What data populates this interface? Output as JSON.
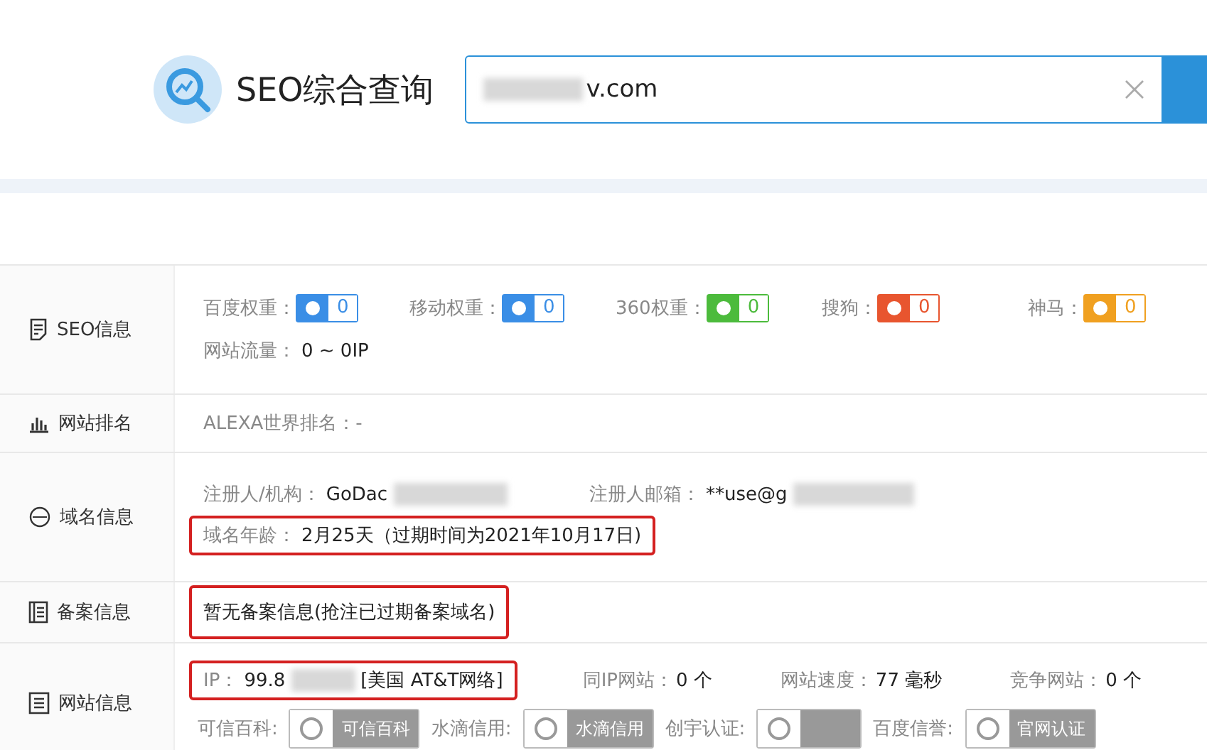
{
  "header": {
    "title": "SEO综合查询",
    "search": {
      "value": "v.com"
    }
  },
  "sections": [
    {
      "kind": "seo",
      "label": "SEO信息",
      "weights": [
        {
          "label": "百度权重：",
          "value": "0",
          "color": "#3a8ee6"
        },
        {
          "label": "移动权重：",
          "value": "0",
          "color": "#3a8ee6"
        },
        {
          "label": "360权重：",
          "value": "0",
          "color": "#4cbb3c"
        },
        {
          "label": "搜狗：",
          "value": "0",
          "color": "#e8552f"
        },
        {
          "label": "神马：",
          "value": "0",
          "color": "#f0a020"
        }
      ],
      "traffic": {
        "label": "网站流量：",
        "value": "0 ~ 0IP"
      }
    },
    {
      "kind": "rank",
      "label": "网站排名",
      "text": "ALEXA世界排名：-"
    },
    {
      "kind": "domain",
      "label": "域名信息",
      "registrant": {
        "label": "注册人/机构：",
        "value": "GoDac"
      },
      "email": {
        "label": "注册人邮箱：",
        "value": "**use@g"
      },
      "age": {
        "label": "域名年龄：",
        "value": "2月25天（过期时间为2021年10月17日)",
        "highlighted": true
      }
    },
    {
      "kind": "icp",
      "label": "备案信息",
      "text": "暂无备案信息(抢注已过期备案域名)",
      "highlighted": true
    },
    {
      "kind": "site",
      "label": "网站信息",
      "ip": {
        "label": "IP：",
        "value_start": "99.8",
        "value_end": "[美国 AT&T网络]",
        "highlighted": true
      },
      "stats": [
        {
          "label": "同IP网站：",
          "value": "0 个"
        },
        {
          "label": "网站速度：",
          "value": "77 毫秒"
        },
        {
          "label": "竞争网站：",
          "value": "0 个"
        }
      ],
      "credits": [
        {
          "label": "可信百科:",
          "badge": "可信百科"
        },
        {
          "label": "水滴信用:",
          "badge": "水滴信用"
        },
        {
          "label": "创宇认证:"
        },
        {
          "label": "百度信誉:",
          "badge": "官网认证"
        }
      ]
    }
  ]
}
